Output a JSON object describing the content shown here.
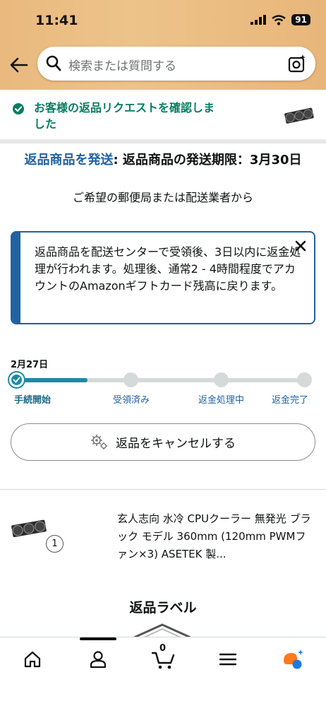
{
  "status_bar": {
    "time": "11:41",
    "battery": "91"
  },
  "search": {
    "placeholder": "検索または質問する"
  },
  "confirmation": {
    "message": "お客様の返品リクエストを確認しました"
  },
  "deadline": {
    "action_link": "返品商品を発送",
    "text": ": 返品商品の発送期限：3月30日",
    "subtitle": "ご希望の郵便局または配送業者から"
  },
  "info_box": {
    "message": "返品商品を配送センターで受領後、3日以内に返金処理が行われます。処理後、通常2 - 4時間程度でアカウントのAmazonギフトカード残高に戻ります。"
  },
  "progress": {
    "date": "2月27日",
    "steps": [
      {
        "label": "手続開始",
        "done": true
      },
      {
        "label": "受領済み",
        "done": false
      },
      {
        "label": "返金処理中",
        "done": false
      },
      {
        "label": "返金完了",
        "done": false
      }
    ]
  },
  "cancel_button": {
    "label": "返品をキャンセルする"
  },
  "product": {
    "title": "玄人志向 水冷 CPUクーラー 無発光 ブラック モデル 360mm (120mm PWMファン×3) ASETEK 製...",
    "quantity": "1"
  },
  "return_label": {
    "heading": "返品ラベル"
  },
  "tab_bar": {
    "cart_count": "0",
    "tabs": [
      "home-icon",
      "account-icon",
      "cart-icon",
      "menu-icon",
      "rufus-icon"
    ]
  },
  "colors": {
    "accent": "#2162a1",
    "success": "#067d62",
    "progress": "#1b8aa4"
  }
}
